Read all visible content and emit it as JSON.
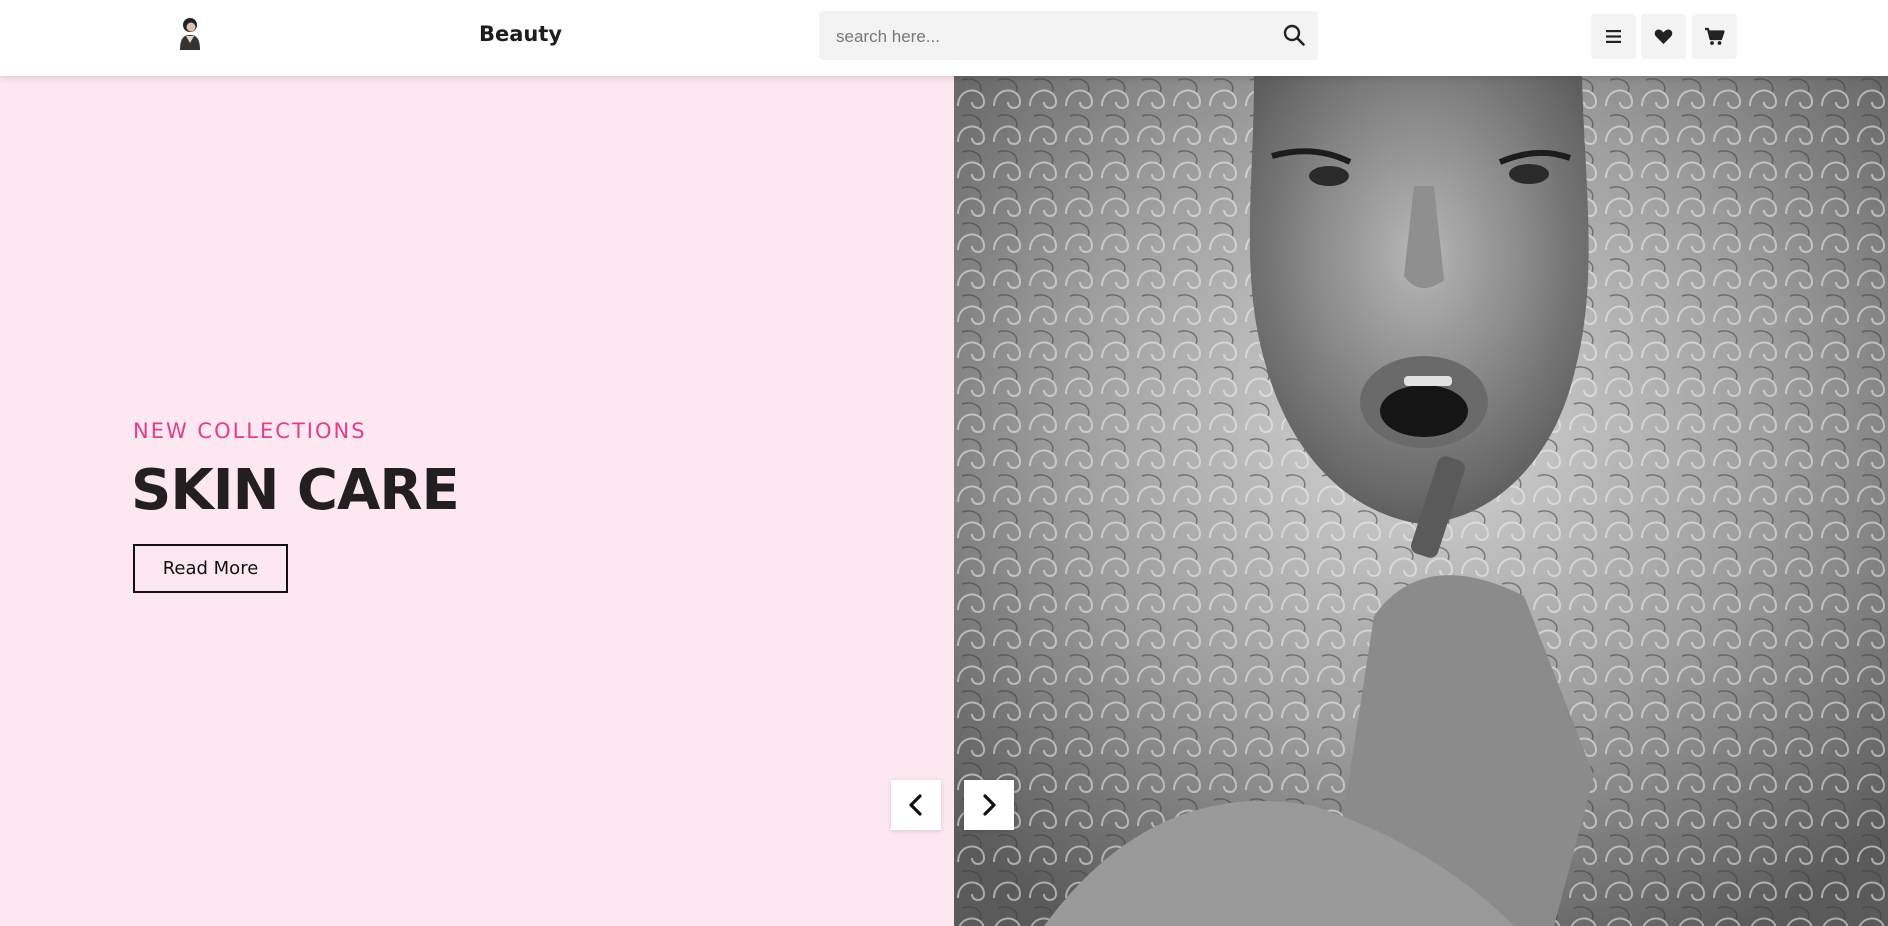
{
  "header": {
    "brand": "Beauty",
    "search": {
      "placeholder": "search here...",
      "value": ""
    },
    "icons": [
      "menu-icon",
      "heart-icon",
      "cart-icon"
    ]
  },
  "hero": {
    "kicker": "NEW COLLECTIONS",
    "title": "SKIN CARE",
    "button_label": "Read More",
    "background_color": "#fde7f0",
    "accent_color": "#e23e89",
    "image_description": "black-and-white portrait of woman with curly hair applying lipstick"
  },
  "slider": {
    "prev_icon": "chevron-left-icon",
    "next_icon": "chevron-right-icon"
  }
}
